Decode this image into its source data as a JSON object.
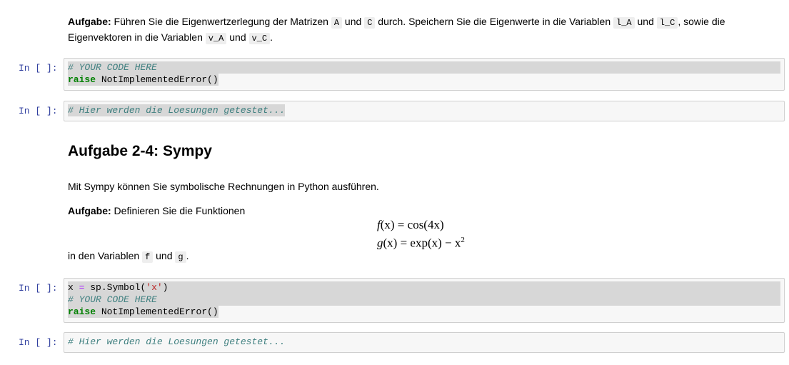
{
  "para1": {
    "lead": "Aufgabe:",
    "text1": " Führen Sie die Eigenwertzerlegung der Matrizen ",
    "code_A": "A",
    "und1": " und ",
    "code_C": "C",
    "text2": " durch. Speichern Sie die Eigenwerte in die Variablen ",
    "code_lA": "l_A",
    "und2": " und ",
    "code_lC": "l_C",
    "text3": ", sowie die",
    "text4": "Eigenvektoren in die Variablen ",
    "code_vA": "v_A",
    "und3": " und ",
    "code_vC": "v_C",
    "text5": "."
  },
  "cells": [
    {
      "prompt": "In [ ]:",
      "lines": [
        "# YOUR CODE HERE",
        "raise NotImplementedError()"
      ]
    },
    {
      "prompt": "In [ ]:",
      "lines": [
        "# Hier werden die Loesungen getestet..."
      ]
    },
    {
      "prompt": "In [ ]:",
      "lines": [
        "x = sp.Symbol('x')",
        "# YOUR CODE HERE",
        "raise NotImplementedError()"
      ]
    },
    {
      "prompt": "In [ ]:",
      "lines": [
        "# Hier werden die Loesungen getestet..."
      ]
    }
  ],
  "code_tokens": {
    "comment_your_code": "# YOUR CODE HERE",
    "raise_kw": "raise",
    "raise_rest": " NotImplementedError()",
    "test_comment": "# Hier werden die Loesungen getestet...",
    "x_var": "x",
    "eq": "=",
    "sp_call": "sp.Symbol(",
    "str_x": "'x'",
    "close_paren": ")"
  },
  "heading": "Aufgabe 2-4: Sympy",
  "para2": "Mit Sympy können Sie symbolische Rechnungen in Python ausführen.",
  "para3": {
    "lead": "Aufgabe:",
    "text": " Definieren Sie die Funktionen"
  },
  "formulas": {
    "f_lhs": "f",
    "f_rest": "(x) = cos(4x)",
    "g_lhs": "g",
    "g_rest": "(x) = exp(x) − x",
    "g_sup": "2"
  },
  "para4": {
    "text1": "in den Variablen ",
    "code_f": "f",
    "und": " und ",
    "code_g": "g",
    "text2": "."
  }
}
